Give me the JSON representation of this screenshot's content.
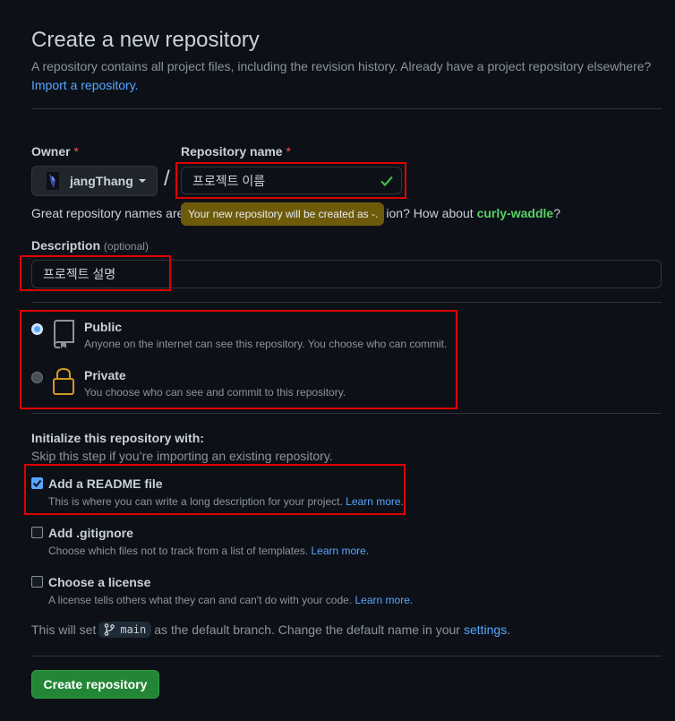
{
  "header": {
    "title": "Create a new repository",
    "subtitle": "A repository contains all project files, including the revision history. Already have a project repository elsewhere?",
    "import_link": "Import a repository."
  },
  "owner": {
    "label": "Owner",
    "required_mark": "*",
    "value": "jangThang"
  },
  "repo_name": {
    "label": "Repository name",
    "required_mark": "*",
    "value": "프로젝트 이름",
    "separator": "/"
  },
  "name_help": {
    "prefix": "Great repository names are",
    "suffix": "ion? How about",
    "suggestion": "curly-waddle",
    "end": "?"
  },
  "tooltip": "Your new repository will be created as -.",
  "description": {
    "label": "Description",
    "optional": "(optional)",
    "value": "프로젝트 설명"
  },
  "visibility": {
    "public": {
      "title": "Public",
      "desc": "Anyone on the internet can see this repository. You choose who can commit.",
      "selected": true
    },
    "private": {
      "title": "Private",
      "desc": "You choose who can see and commit to this repository.",
      "selected": false
    }
  },
  "init": {
    "heading": "Initialize this repository with:",
    "skip": "Skip this step if you’re importing an existing repository.",
    "readme": {
      "title": "Add a README file",
      "desc": "This is where you can write a long description for your project.",
      "link": "Learn more.",
      "checked": true
    },
    "gitignore": {
      "title": "Add .gitignore",
      "desc": "Choose which files not to track from a list of templates.",
      "link": "Learn more.",
      "checked": false
    },
    "license": {
      "title": "Choose a license",
      "desc": "A license tells others what they can and can't do with your code.",
      "link": "Learn more.",
      "checked": false
    }
  },
  "branch_note": {
    "prefix": "This will set",
    "branch": "main",
    "middle": "as the default branch. Change the default name in your",
    "link": "settings",
    "end": "."
  },
  "submit_label": "Create repository",
  "colors": {
    "accent": "#58a6ff",
    "success": "#238636",
    "highlight": "#e00000"
  }
}
